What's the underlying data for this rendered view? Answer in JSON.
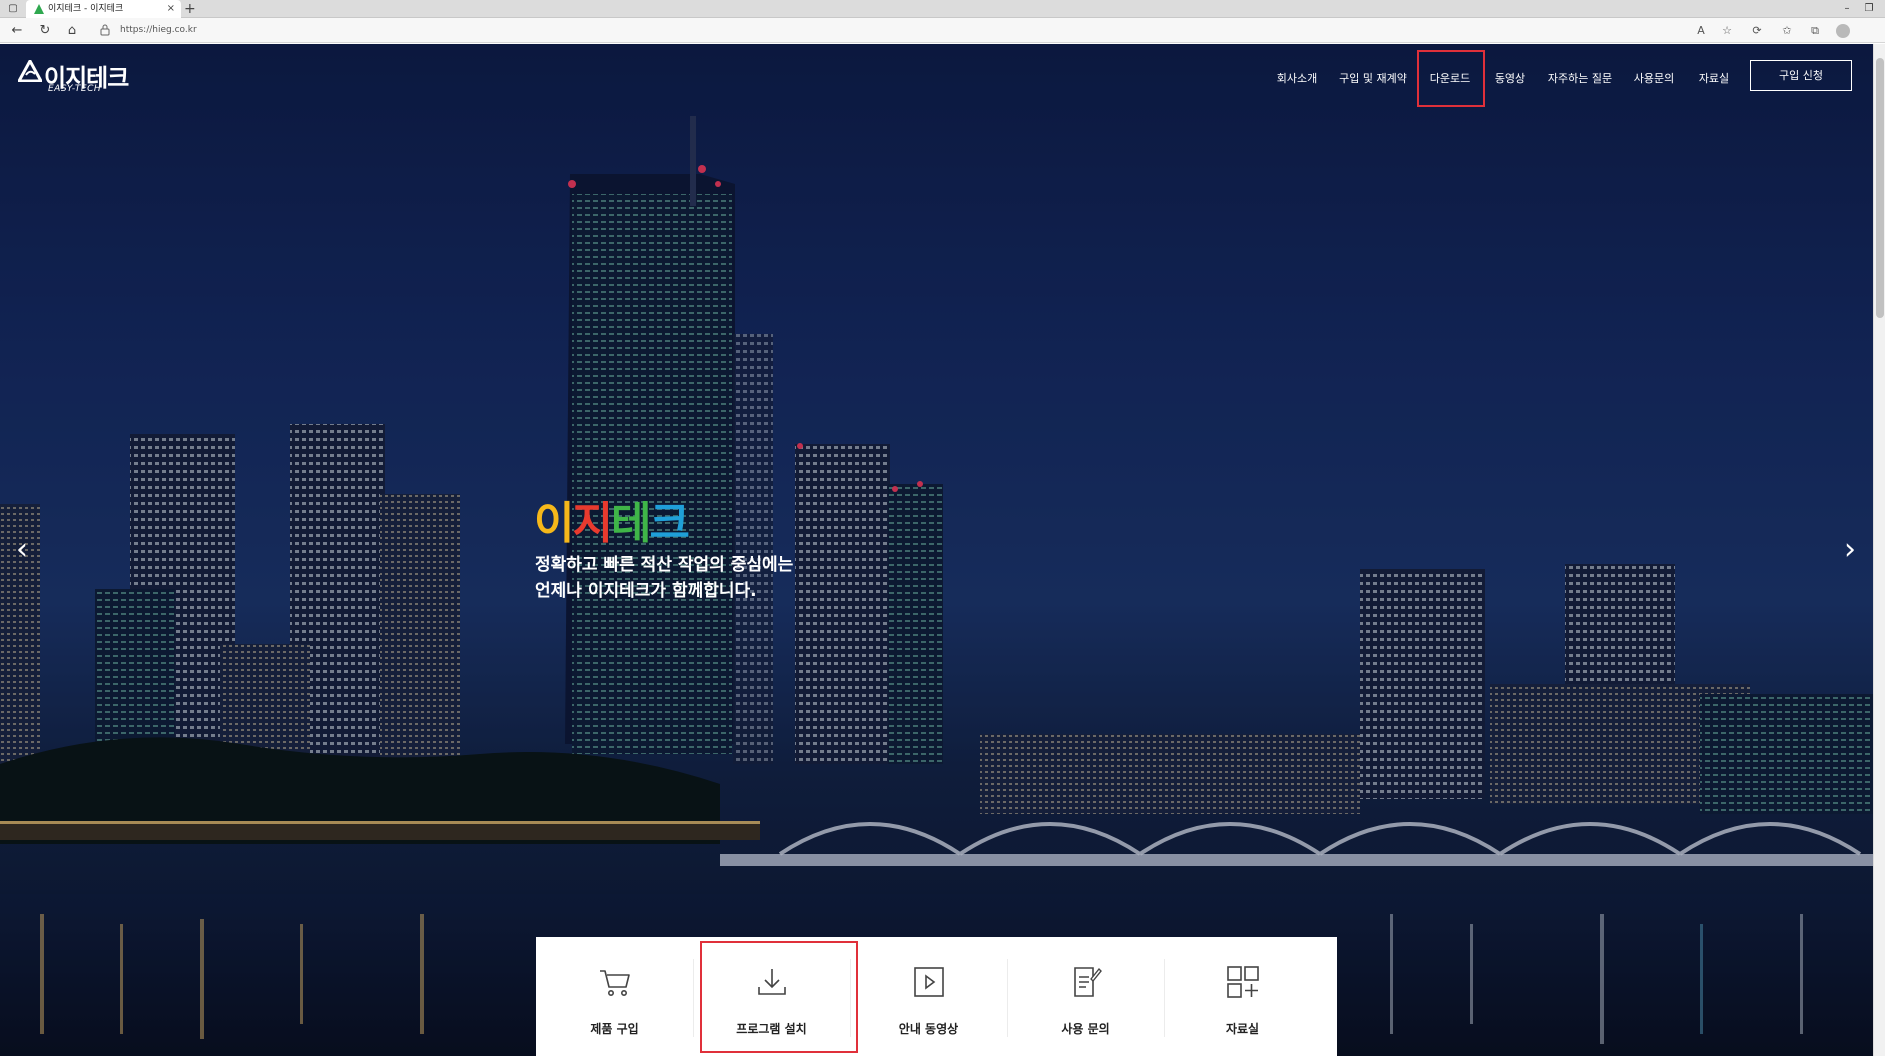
{
  "browser": {
    "tab_title": "이지테크 - 이지테크",
    "tab_close": "×",
    "new_tab": "+",
    "url": "https://hieg.co.kr"
  },
  "header": {
    "logo_text": "이지테크",
    "logo_sub": "EASY-TECH",
    "nav": [
      "회사소개",
      "구입 및 재계약",
      "다운로드",
      "동영상",
      "자주하는 질문",
      "사용문의",
      "자료실"
    ],
    "cta": "구입 신청"
  },
  "hero": {
    "brand_chars": [
      "이",
      "지",
      "테",
      "크"
    ],
    "brand_colors": [
      "#f6b81a",
      "#e83a2e",
      "#3fb548",
      "#1f9fd8"
    ],
    "line1": "정확하고 빠른 적산 작업의 중심에는",
    "line2": "언제나 이지테크가 함께합니다.",
    "prev_arrow": "‹",
    "next_arrow": "›"
  },
  "quick_menu": [
    {
      "label": "제품 구입",
      "icon": "cart-icon"
    },
    {
      "label": "프로그램 설치",
      "icon": "download-icon"
    },
    {
      "label": "안내 동영상",
      "icon": "play-icon"
    },
    {
      "label": "사용 문의",
      "icon": "document-edit-icon"
    },
    {
      "label": "자료실",
      "icon": "grid-plus-icon"
    }
  ],
  "colors": {
    "highlight": "#e0303a",
    "hero_bg": "#13285e"
  }
}
